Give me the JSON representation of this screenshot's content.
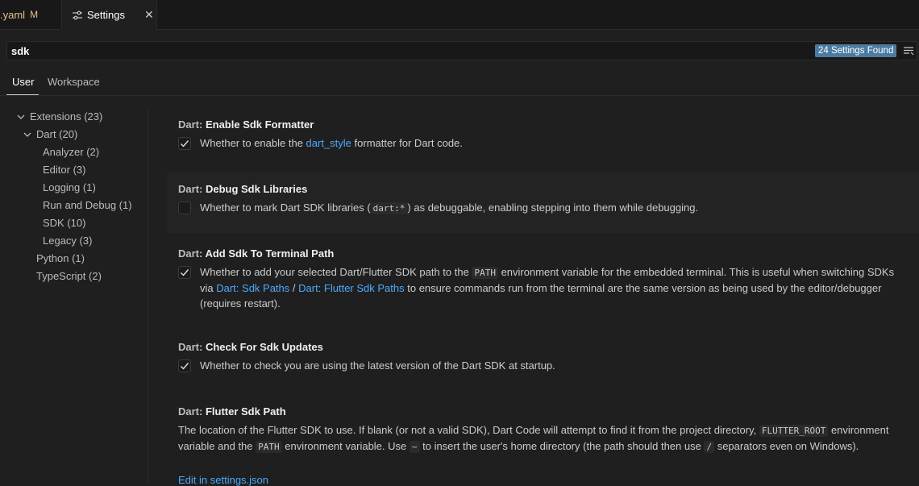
{
  "tabs": [
    {
      "label": ".yaml",
      "modified": "M"
    },
    {
      "label": "Settings",
      "close": "✕"
    }
  ],
  "search": {
    "value": "sdk",
    "results_badge": "24 Settings Found"
  },
  "scope_tabs": {
    "user": "User",
    "workspace": "Workspace"
  },
  "toc": [
    {
      "label": "Extensions (23)"
    },
    {
      "label": "Dart (20)"
    },
    {
      "label": "Analyzer (2)"
    },
    {
      "label": "Editor (3)"
    },
    {
      "label": "Logging (1)"
    },
    {
      "label": "Run and Debug (1)"
    },
    {
      "label": "SDK (10)"
    },
    {
      "label": "Legacy (3)"
    },
    {
      "label": "Python (1)"
    },
    {
      "label": "TypeScript (2)"
    }
  ],
  "settings": [
    {
      "category": "Dart: ",
      "name": "Enable Sdk Formatter",
      "checked": true,
      "desc_pre": "Whether to enable the ",
      "desc_link": "dart_style",
      "desc_post": " formatter for Dart code."
    },
    {
      "category": "Dart: ",
      "name": "Debug Sdk Libraries",
      "checked": false,
      "desc_pre": "Whether to mark Dart SDK libraries (",
      "desc_code": "dart:*",
      "desc_post": ") as debuggable, enabling stepping into them while debugging."
    },
    {
      "category": "Dart: ",
      "name": "Add Sdk To Terminal Path",
      "checked": true,
      "desc_1": "Whether to add your selected Dart/Flutter SDK path to the ",
      "desc_code": "PATH",
      "desc_2": " environment variable for the embedded terminal. This is useful when switching SDKs via ",
      "desc_link1": "Dart: Sdk Paths",
      "desc_sep": " / ",
      "desc_link2": "Dart: Flutter Sdk Paths",
      "desc_3": " to ensure commands run from the terminal are the same version as being used by the editor/debugger (requires restart)."
    },
    {
      "category": "Dart: ",
      "name": "Check For Sdk Updates",
      "checked": true,
      "desc": "Whether to check you are using the latest version of the Dart SDK at startup."
    },
    {
      "category": "Dart: ",
      "name": "Flutter Sdk Path",
      "desc_1": "The location of the Flutter SDK to use. If blank (or not a valid SDK), Dart Code will attempt to find it from the project directory, ",
      "desc_code1": "FLUTTER_ROOT",
      "desc_2": " environment variable and the ",
      "desc_code2": "PATH",
      "desc_3": " environment variable. Use ",
      "desc_code3": "~",
      "desc_4": " to insert the user's home directory (the path should then use ",
      "desc_code4": "/",
      "desc_5": " separators even on Windows).",
      "edit_link": "Edit in settings.json"
    }
  ]
}
